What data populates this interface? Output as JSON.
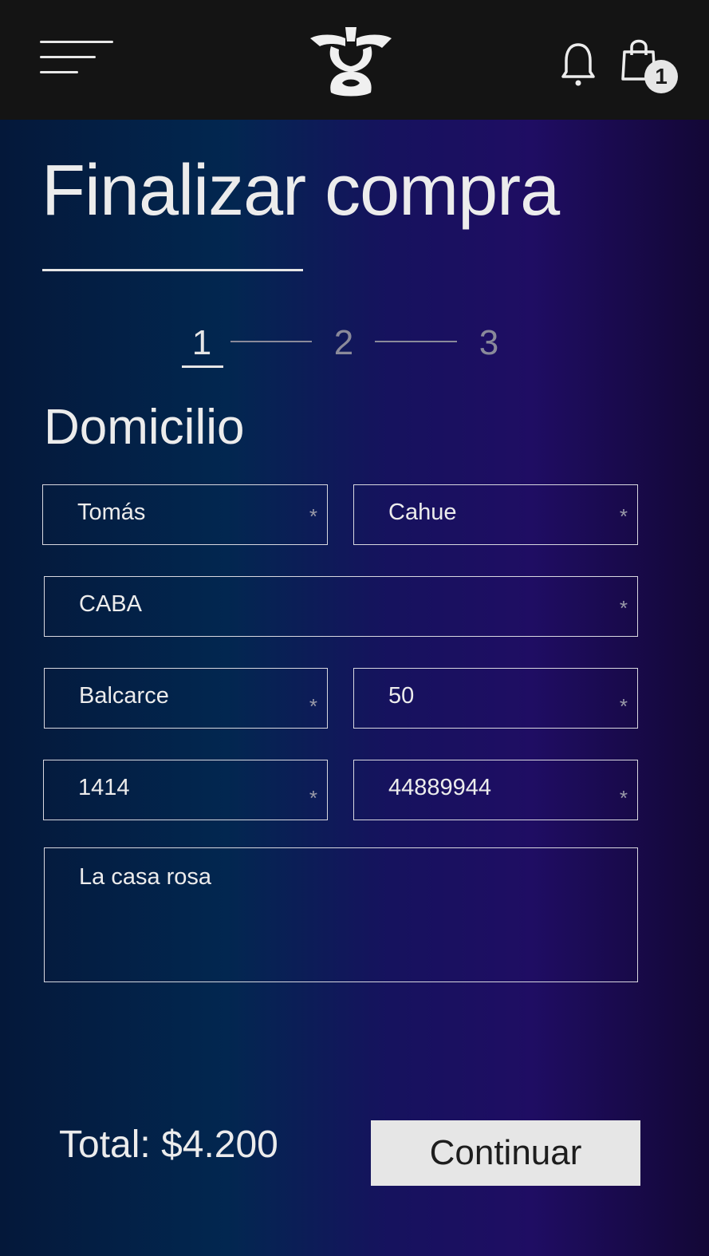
{
  "header": {
    "menu_icon": "hamburger-menu-icon",
    "logo_icon": "brand-logo",
    "notification_icon": "bell-icon",
    "cart_icon": "shopping-bag-icon",
    "cart_count": "1"
  },
  "page": {
    "title": "Finalizar compra",
    "steps": [
      "1",
      "2",
      "3"
    ],
    "active_step": "1",
    "section_title": "Domicilio"
  },
  "form": {
    "first_name": "Tomás",
    "last_name": "Cahue",
    "city": "CABA",
    "street": "Balcarce",
    "street_number": "50",
    "postal_code": "1414",
    "phone": "44889944",
    "notes": "La casa rosa",
    "required_marker": "*"
  },
  "footer": {
    "total": "Total: $4.200",
    "continue_label": "Continuar"
  },
  "colors": {
    "header_bg": "#141414",
    "gradient_left": "#022750",
    "gradient_right": "#1f0d63",
    "button_bg": "#e6e6e6"
  }
}
